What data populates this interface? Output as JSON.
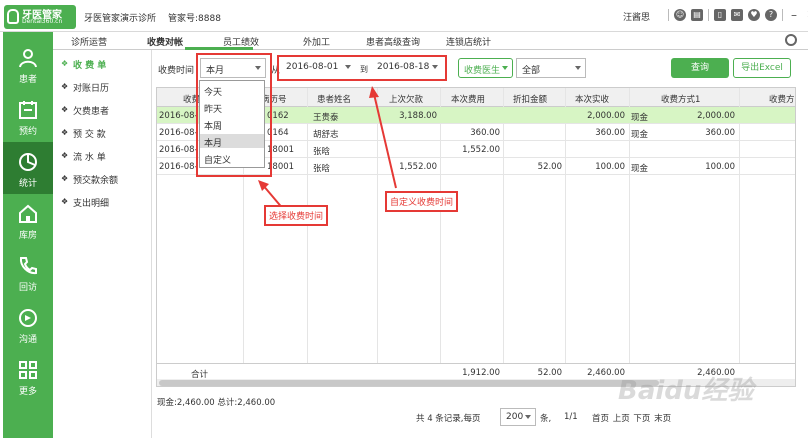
{
  "header": {
    "logo_title": "牙医管家",
    "logo_sub": "Dental360.cn",
    "clinic": "牙医管家演示诊所",
    "manager": "管家号:8888",
    "user": "汪酱思"
  },
  "sidebar": [
    {
      "label": "患者",
      "icon": "patient-icon"
    },
    {
      "label": "预约",
      "icon": "calendar-icon"
    },
    {
      "label": "统计",
      "icon": "pie-chart-icon"
    },
    {
      "label": "库房",
      "icon": "house-icon"
    },
    {
      "label": "回访",
      "icon": "phone-icon"
    },
    {
      "label": "沟通",
      "icon": "chat-icon"
    },
    {
      "label": "更多",
      "icon": "grid-icon"
    }
  ],
  "tabs": [
    "诊所运营",
    "收费对帐",
    "员工绩效",
    "外加工",
    "患者高级查询",
    "连锁店统计"
  ],
  "submenu": [
    "收 费 单",
    "对账日历",
    "欠费患者",
    "预 交 款",
    "流 水 单",
    "预交款余额",
    "支出明细"
  ],
  "filter": {
    "time_label": "收费时间",
    "period": "本月",
    "from_label": "从",
    "start_date": "2016-08-01",
    "to_label": "到",
    "end_date": "2016-08-18",
    "doctor_label": "收费医生",
    "doctor_value": "全部",
    "query_button": "查询",
    "export_button": "导出Excel"
  },
  "dropdown": [
    "今天",
    "昨天",
    "本周",
    "本月",
    "自定义"
  ],
  "table": {
    "headers": [
      "收费日期",
      "病历号",
      "患者姓名",
      "上次欠款",
      "本次费用",
      "折扣金额",
      "本次实收",
      "收费方式1",
      "收费方"
    ],
    "rows": [
      [
        "2016-08-",
        "0162",
        "王贵泰",
        "3,188.00",
        "",
        "",
        "2,000.00",
        "现金",
        "2,000.00"
      ],
      [
        "2016-08-",
        "0164",
        "胡舒志",
        "",
        "360.00",
        "",
        "360.00",
        "现金",
        "360.00"
      ],
      [
        "2016-08-",
        "18001",
        "张晗",
        "",
        "1,552.00",
        "",
        "",
        "",
        ""
      ],
      [
        "2016-08-",
        "18001",
        "张晗",
        "1,552.00",
        "",
        "52.00",
        "100.00",
        "现金",
        "100.00"
      ]
    ],
    "total_label": "合计",
    "totals": [
      "1,912.00",
      "52.00",
      "2,460.00",
      "2,460.00"
    ]
  },
  "annotations": {
    "select_time": "选择收费时间",
    "custom_time": "自定义收费时间"
  },
  "footer": {
    "summary": "现金:2,460.00  总计:2,460.00",
    "records": "共 4 条记录,每页",
    "page_size": "200",
    "unit": "条,",
    "page_count": "1/1",
    "nav": "首页 上页 下页 末页"
  },
  "watermark": "Baidu经验",
  "colors": {
    "brand_green": "#4caf50",
    "annotation_red": "#e53935",
    "selected_row": "#d7f5c4"
  }
}
